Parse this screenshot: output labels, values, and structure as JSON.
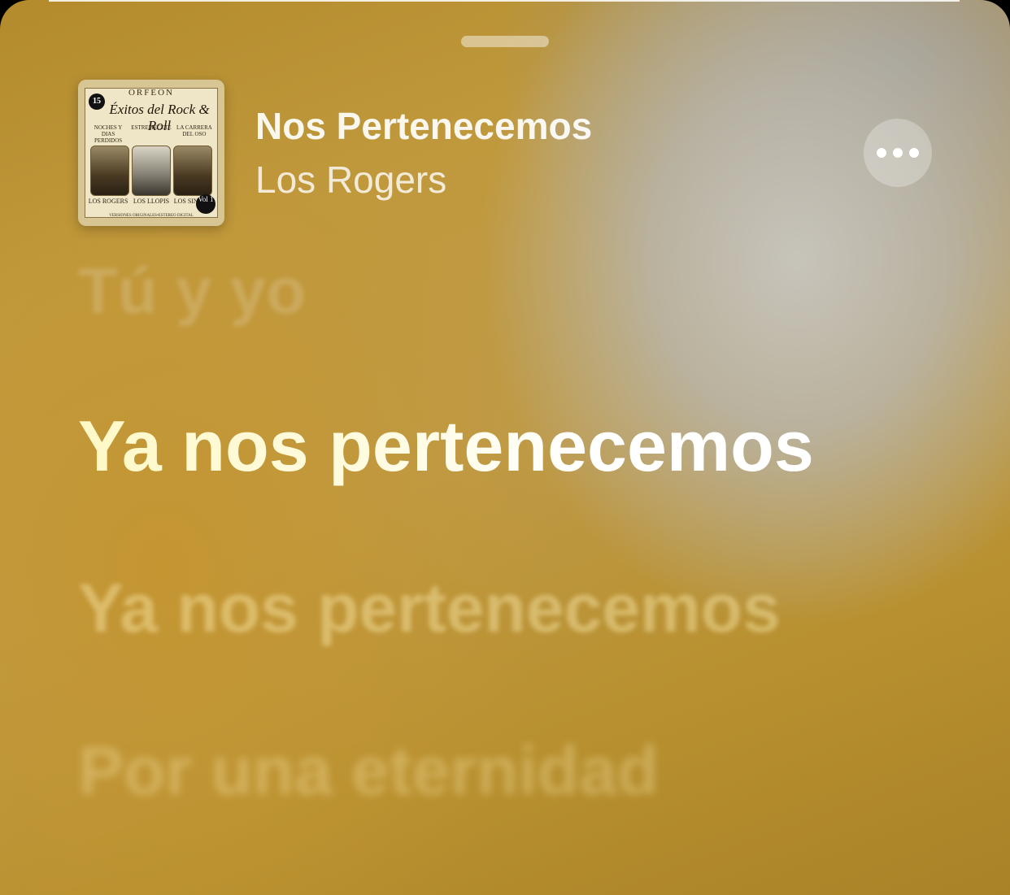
{
  "now_playing": {
    "title": "Nos Pertenecemos",
    "artist": "Los Rogers",
    "more_icon": "ellipsis-icon"
  },
  "artwork": {
    "brand": "ORFEON",
    "badge": "15",
    "badge_sub": "Éxitos",
    "script": "Éxitos del Rock & Roll",
    "songs": [
      "NOCHES Y DIAS PERDIDOS",
      "ESTREMECETE",
      "LA CARRERA DEL OSO"
    ],
    "artists": [
      "LOS ROGERS",
      "LOS LLOPIS",
      "LOS SINNERS"
    ],
    "vol": "Vol 1",
    "footer": "VERSIONES ORIGINALES•ESTEREO DIGITAL"
  },
  "lyrics": {
    "past": "Tú y yo",
    "current": "Ya nos pertenecemos",
    "next": [
      "Ya nos pertenecemos",
      "Por una eternidad"
    ]
  }
}
